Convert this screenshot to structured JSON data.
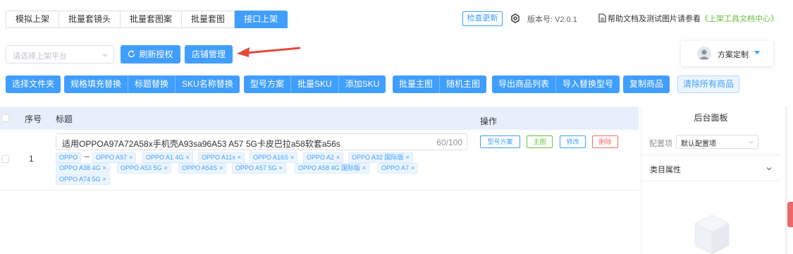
{
  "tabs": [
    {
      "label": "模拟上架",
      "active": false
    },
    {
      "label": "批量套镜头",
      "active": false
    },
    {
      "label": "批量套图案",
      "active": false
    },
    {
      "label": "批量套图",
      "active": false
    },
    {
      "label": "接口上架",
      "active": true
    }
  ],
  "header": {
    "check_update": "检查更新",
    "version": "版本号: V2.0.1",
    "help_prefix": "帮助文档及测试图片请参看",
    "help_link": "《上架工具文档中心》"
  },
  "controls": {
    "platform_placeholder": "请选择上架平台",
    "refresh_label": "刷新授权",
    "shop_label": "店铺管理",
    "scheme_label": "方案定制"
  },
  "toolbar": {
    "groups": [
      [
        "选择文件夹"
      ],
      [
        "规格填充替换",
        "标题替换",
        "SKU名称替换"
      ],
      [
        "型号方案",
        "批量SKU",
        "添加SKU"
      ],
      [
        "批量主图",
        "随机主图"
      ],
      [
        "导出商品列表",
        "导入替换型号"
      ],
      [
        "复制商品"
      ]
    ],
    "clear_all": "清除所有商品"
  },
  "table": {
    "headers": {
      "index": "序号",
      "title": "标题",
      "ops": "操作"
    },
    "rows": [
      {
        "index": "1",
        "title": "适用OPPOA97A72A58x手机壳A93sa96A53 A57 5G卡皮巴拉a58软套a56s",
        "count": "60/100",
        "brand": "OPPO",
        "dash": "–",
        "models": [
          "OPPO A97",
          "OPPO A1 4G",
          "OPPO A11x",
          "OPPO A16S",
          "OPPO A2",
          "OPPO A32 国际版",
          "OPPO A38 4G",
          "OPPO A53 5G",
          "OPPO A54S",
          "OPPO A57 5G",
          "OPPO A58 4G 国际版",
          "OPPO A7",
          "OPPO A74 5G"
        ],
        "ops": {
          "model_scheme": "型号方案",
          "main_image": "主图",
          "edit": "修改",
          "delete": "删除"
        }
      }
    ]
  },
  "panel": {
    "title": "后台面板",
    "config_label": "配置项",
    "config_value": "默认配置项",
    "category": "类目属性"
  },
  "colors": {
    "primary": "#409eff",
    "success": "#67c23a",
    "danger": "#f56c6c",
    "arrow": "#e5483a"
  },
  "icons": [
    "gear-icon",
    "document-icon",
    "refresh-icon",
    "user-icon",
    "caret-down-icon",
    "chevron-down-icon",
    "close-icon",
    "arrow-annotation"
  ]
}
